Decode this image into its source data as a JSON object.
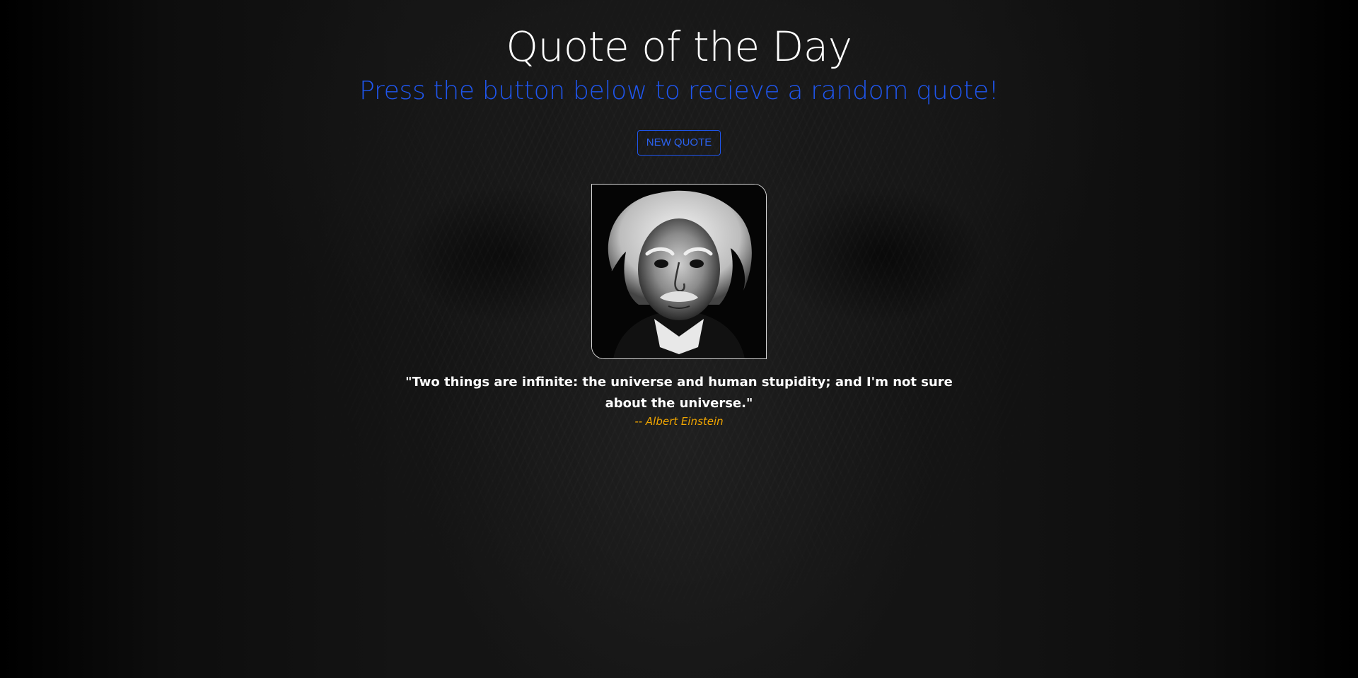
{
  "header": {
    "title": "Quote of the Day",
    "subtitle": "Press the button below to recieve a random quote!"
  },
  "actions": {
    "new_quote_label": "NEW QUOTE"
  },
  "quote": {
    "text": "\"Two things are infinite: the universe and human stupidity; and I'm not sure about the universe.\"",
    "author": "-- Albert Einstein",
    "portrait_icon": "einstein-portrait"
  },
  "colors": {
    "background": "#000000",
    "title": "#ffffff",
    "subtitle": "#1f56ee",
    "button_border": "#1f56ee",
    "quote_text": "#ffffff",
    "author": "#f0a500"
  }
}
